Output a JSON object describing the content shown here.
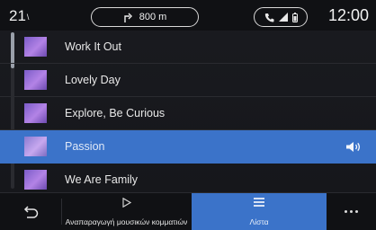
{
  "status": {
    "temperature": "21",
    "temperature_unit": "\\",
    "nav_distance": "800 m",
    "clock": "12:00"
  },
  "tracks": [
    {
      "title": "Work It Out",
      "active": false
    },
    {
      "title": "Lovely Day",
      "active": false
    },
    {
      "title": "Explore, Be Curious",
      "active": false
    },
    {
      "title": "Passion",
      "active": true
    },
    {
      "title": "We Are Family",
      "active": false
    }
  ],
  "bottombar": {
    "play_label": "Αναπαραγωγή μουσικών κομματιών",
    "list_label": "Λίστα"
  },
  "icons": {
    "back": "back-arrow-icon",
    "play": "play-icon",
    "list": "list-icon",
    "more": "more-icon",
    "speaker": "speaker-icon",
    "phone": "phone-icon",
    "signal": "signal-icon",
    "battery": "battery-icon",
    "nav_arrow": "turn-arrow-icon"
  },
  "colors": {
    "accent": "#3b73c9",
    "background": "#15161a"
  }
}
